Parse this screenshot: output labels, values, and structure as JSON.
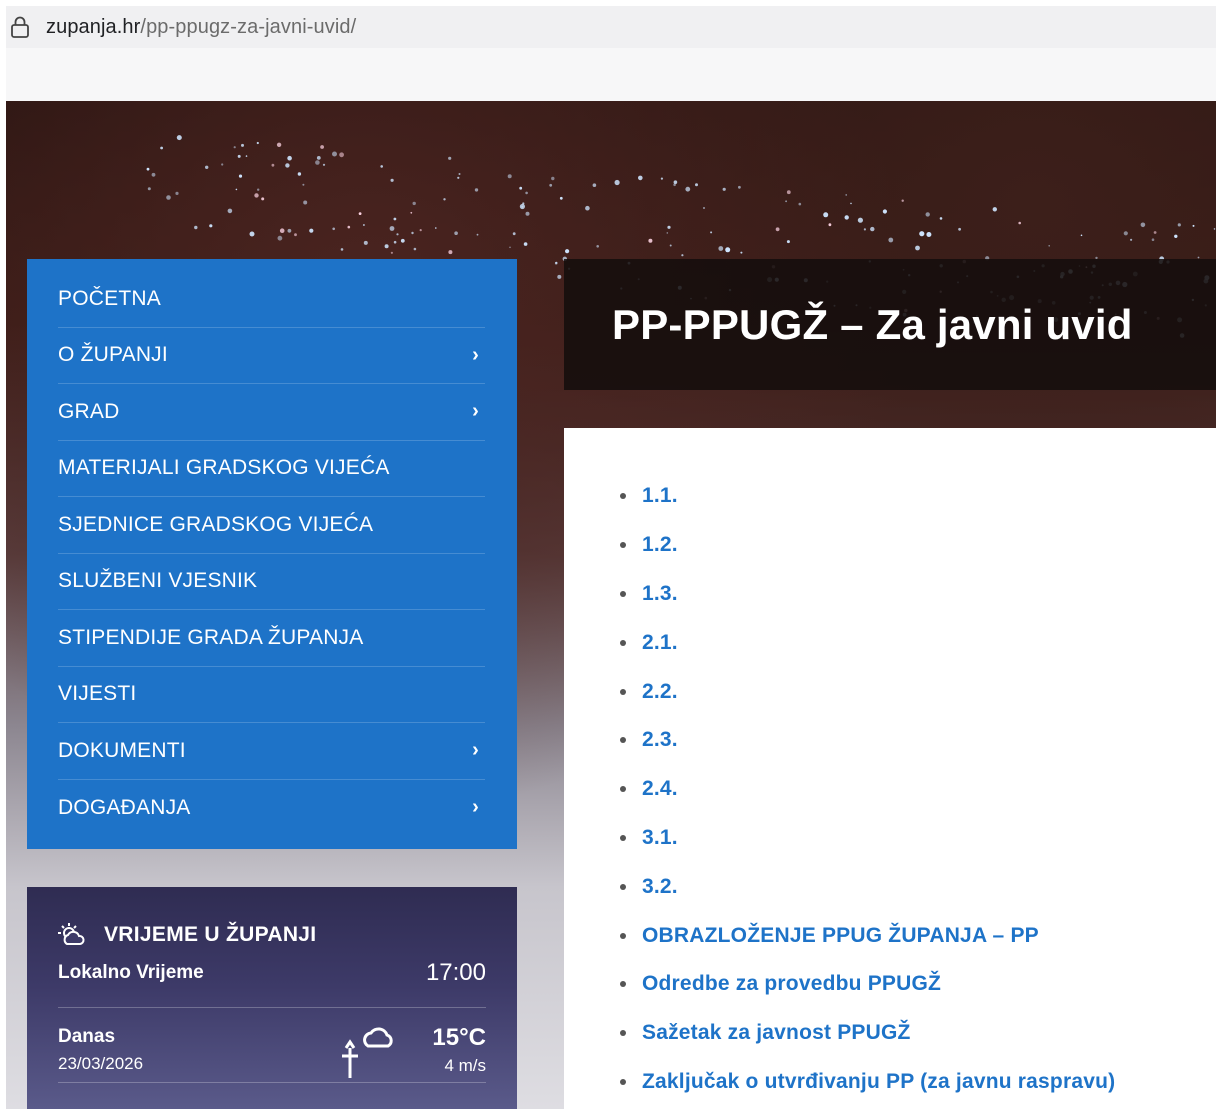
{
  "browser": {
    "url_host": "zupanja.hr",
    "url_path": "/pp-ppugz-za-javni-uvid/"
  },
  "sidebar": {
    "items": [
      {
        "label": "POČETNA",
        "has_submenu": false
      },
      {
        "label": "O ŽUPANJI",
        "has_submenu": true
      },
      {
        "label": "GRAD",
        "has_submenu": true
      },
      {
        "label": "MATERIJALI GRADSKOG VIJEĆA",
        "has_submenu": false
      },
      {
        "label": "SJEDNICE GRADSKOG VIJEĆA",
        "has_submenu": false
      },
      {
        "label": "SLUŽBENI VJESNIK",
        "has_submenu": false
      },
      {
        "label": "STIPENDIJE GRADA ŽUPANJA",
        "has_submenu": false
      },
      {
        "label": "VIJESTI",
        "has_submenu": false
      },
      {
        "label": "DOKUMENTI",
        "has_submenu": true
      },
      {
        "label": "DOGAĐANJA",
        "has_submenu": true
      }
    ],
    "chevron": "›"
  },
  "weather": {
    "title": "VRIJEME U ŽUPANJI",
    "local_label": "Lokalno Vrijeme",
    "local_time": "17:00",
    "today_label": "Danas",
    "today_date": "23/03/2026",
    "temperature": "15°C",
    "wind": "4 m/s",
    "icon": "partly-cloudy-icon"
  },
  "main": {
    "title": "PP-PPUGŽ – Za javni uvid",
    "documents": [
      "1.1.",
      "1.2.",
      "1.3.",
      "2.1.",
      "2.2.",
      "2.3.",
      "2.4.",
      "3.1.",
      "3.2.",
      "OBRAZLOŽENJE PPUG ŽUPANJA – PP",
      "Odredbe za provedbu PPUGŽ",
      "Sažetak za javnost PPUGŽ",
      "Zaključak o utvrđivanju PP (za javnu raspravu)"
    ]
  },
  "colors": {
    "accent": "#1e73c8",
    "title_bg": "#140e0c",
    "weather_bg": "#2f2c52"
  }
}
